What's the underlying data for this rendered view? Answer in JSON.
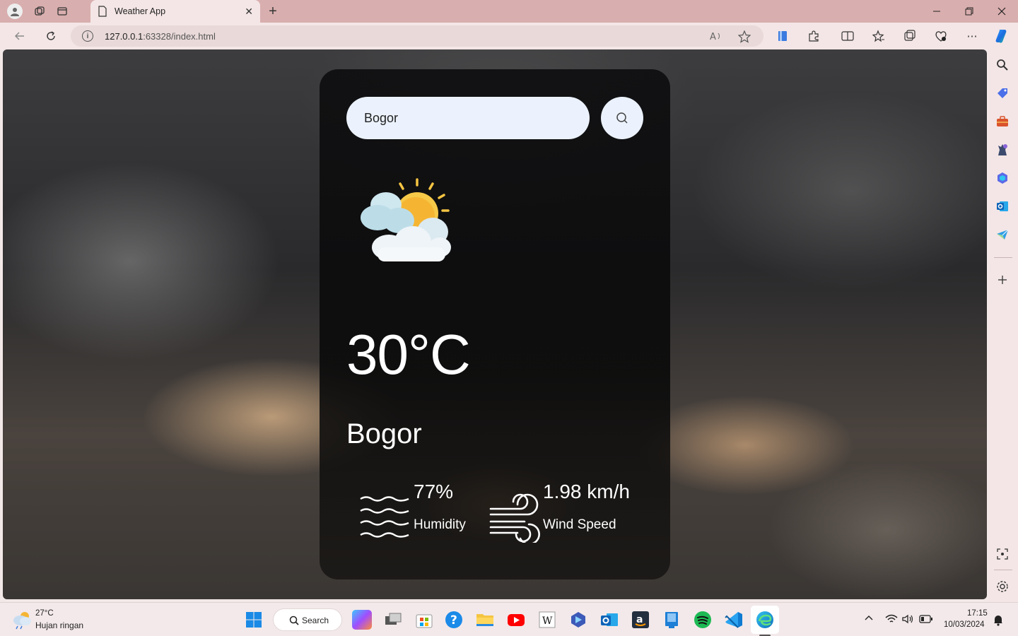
{
  "browser": {
    "tab_title": "Weather App",
    "url_prefix": "127.0.0.1",
    "url_rest": ":63328/index.html"
  },
  "app": {
    "search_value": "Bogor",
    "temperature": "30°C",
    "city": "Bogor",
    "humidity_value": "77%",
    "humidity_label": "Humidity",
    "wind_value": "1.98 km/h",
    "wind_label": "Wind Speed",
    "weather_condition_icon": "sun-behind-clouds-icon"
  },
  "taskbar": {
    "weather_temp": "27°C",
    "weather_desc": "Hujan ringan",
    "search_label": "Search",
    "time": "17:15",
    "date": "10/03/2024"
  },
  "colors": {
    "card_bg": "#0e0e10",
    "search_bg": "#ebf2fd",
    "titlebar": "#d9aeae"
  }
}
